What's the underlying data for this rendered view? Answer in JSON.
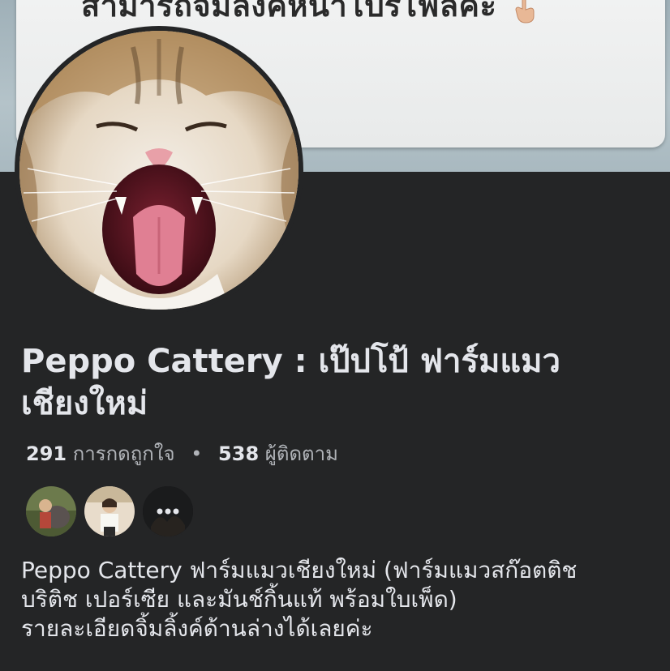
{
  "cover": {
    "text": "สามารถจิ้มลิ้งค์หน้าโปรไฟล์ค่ะ",
    "icon": "pointing-down-hand-icon"
  },
  "profile": {
    "avatar_icon": "cat-avatar-icon",
    "name": "Peppo Cattery : เป๊ปโป้ ฟาร์มแมว เชียงใหม่",
    "likes_count": "291",
    "likes_label": "การกดถูกใจ",
    "separator": "•",
    "followers_count": "538",
    "followers_label": "ผู้ติดตาม"
  },
  "friends": {
    "more_icon": "more-dots-icon"
  },
  "bio": {
    "line1": "Peppo Cattery ฟาร์มแมวเชียงใหม่ (ฟาร์มแมวสก๊อตติช",
    "line2": "บริติช เปอร์เซีย และมันช์กิ้นแท้ พร้อมใบเพ็ด)",
    "line3": "รายละเอียดจิ้มลิ้งค์ด้านล่างได้เลยค่ะ"
  },
  "colors": {
    "background": "#242526",
    "text_primary": "#e4e6eb",
    "text_secondary": "#b0b3b8"
  }
}
